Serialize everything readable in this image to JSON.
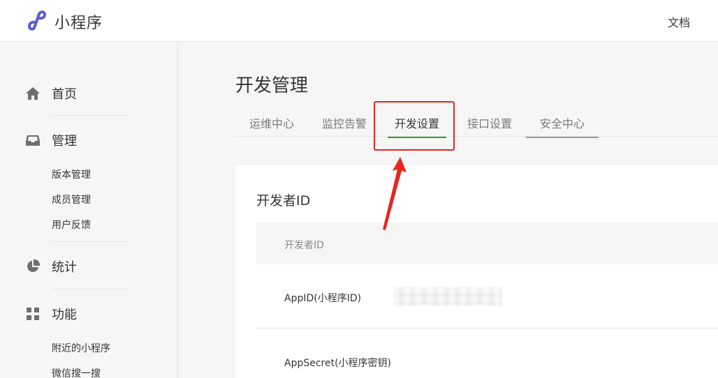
{
  "header": {
    "app_title": "小程序",
    "doc_link": "文档",
    "brand_color": "#5b5bd6"
  },
  "sidebar": {
    "groups": [
      {
        "label": "首页",
        "icon": "home-icon",
        "items": []
      },
      {
        "label": "管理",
        "icon": "inbox-icon",
        "items": [
          "版本管理",
          "成员管理",
          "用户反馈"
        ]
      },
      {
        "label": "统计",
        "icon": "pie-chart-icon",
        "items": []
      },
      {
        "label": "功能",
        "icon": "grid-icon",
        "items": [
          "附近的小程序",
          "微信搜一搜"
        ]
      }
    ]
  },
  "main": {
    "page_title": "开发管理",
    "tabs": [
      {
        "label": "运维中心",
        "active": false
      },
      {
        "label": "监控告警",
        "active": false
      },
      {
        "label": "开发设置",
        "active": true
      },
      {
        "label": "接口设置",
        "active": false
      },
      {
        "label": "安全中心",
        "active": false
      }
    ],
    "card": {
      "title": "开发者ID",
      "table_header": "开发者ID",
      "rows": [
        {
          "label": "AppID(小程序ID)",
          "value_redacted": true
        },
        {
          "label": "AppSecret(小程序密钥)",
          "value_redacted": false
        }
      ]
    }
  },
  "annotation": {
    "highlight_color": "#e6261f"
  },
  "colors": {
    "active_tab_underline": "#1aad19",
    "text": "#353535",
    "muted": "#7a7a7a"
  }
}
